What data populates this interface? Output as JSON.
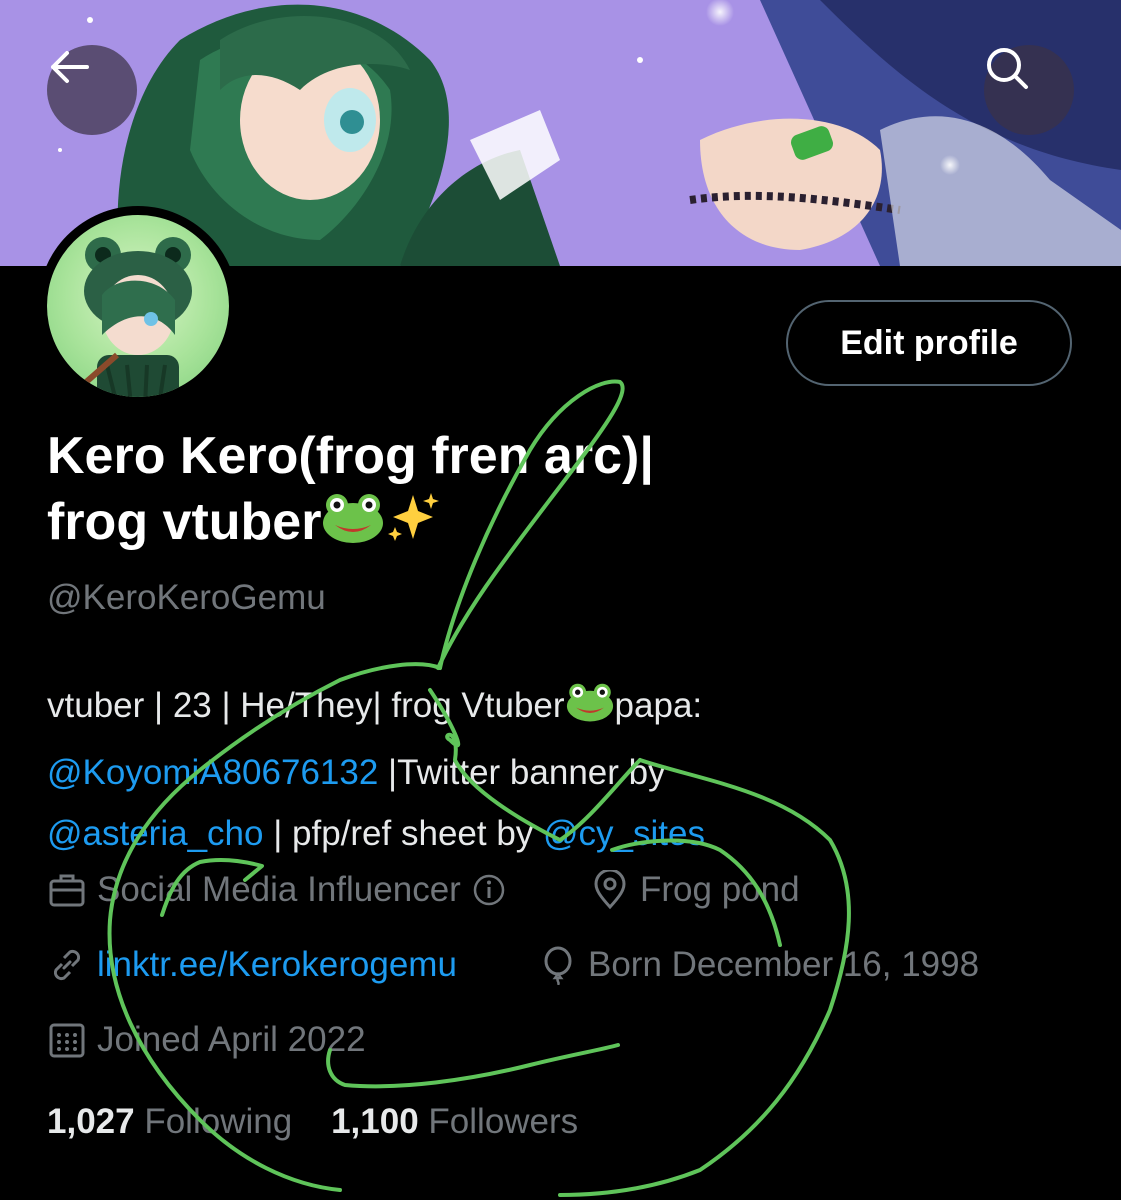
{
  "nav": {
    "back_icon": "arrow-left-icon",
    "search_icon": "search-icon"
  },
  "profile": {
    "edit_label": "Edit profile",
    "name_line1": "Kero Kero(frog fren arc)|",
    "name_line2": "frog vtuber",
    "name_emojis": [
      "frog-face",
      "sparkles"
    ],
    "handle": "@KeroKeroGemu",
    "bio": {
      "part1": "vtuber | 23 | He/They| frog Vtuber",
      "part2": "papa: ",
      "mention1": "@KoyomiA80676132",
      "part3": " |Twitter banner by ",
      "mention2": "@asteria_cho",
      "part4": " | pfp/ref sheet by ",
      "mention3": "@cy_sites"
    },
    "category": "Social Media Influencer",
    "location": "Frog pond",
    "website": "linktr.ee/Kerokerogemu",
    "birthday": "Born December 16, 1998",
    "joined": "Joined April 2022",
    "following_count": "1,027",
    "following_label": "Following",
    "followers_count": "1,100",
    "followers_label": "Followers"
  },
  "colors": {
    "background": "#000000",
    "accent_link": "#1d9bf0",
    "muted_text": "#71767b",
    "annotation_stroke": "#5fc45a"
  }
}
